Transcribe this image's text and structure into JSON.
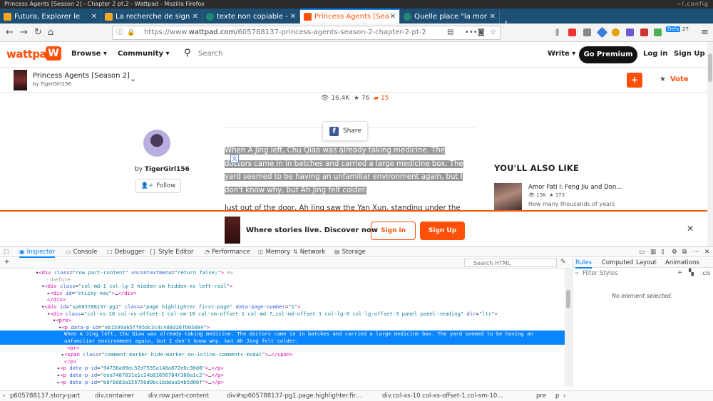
{
  "window": {
    "title": "Princess Agents [Season 2] - Chapter 2 pt.2 - Wattpad - Mozilla Firefox",
    "corner": "~/.config"
  },
  "tabs": [
    {
      "label": "Futura, Explorer le",
      "color": "#f5a623",
      "active": false
    },
    {
      "label": "La recherche de sign",
      "color": "#f5a623",
      "active": false
    },
    {
      "label": "texte non copiable -",
      "color": "#2b6",
      "active": false
    },
    {
      "label": "Princess Agents [Sea",
      "color": "#ff500a",
      "active": true
    },
    {
      "label": "Quelle place \"la mor",
      "color": "#2b6",
      "active": false
    }
  ],
  "nav": {
    "back": "←",
    "forward": "→",
    "reload": "↻",
    "home": "⌂",
    "url_prefix": "https://www.",
    "url_domain": "wattpad.com",
    "url_path": "/605788137-princess-agents-season-2-chapter-2-pt-2",
    "more": "•••",
    "menu": "≡",
    "profile_badge": "Defa",
    "counter": "27"
  },
  "site": {
    "brand": "wattpad",
    "browse": "Browse ▾",
    "community": "Community ▾",
    "search_placeholder": "Search",
    "write": "Write ▾",
    "premium": "Go Premium",
    "login": "Log in",
    "signup": "Sign Up"
  },
  "story": {
    "title": "Princess Agents [Season 2]",
    "by": "by TigerGirl156",
    "plus": "+",
    "vote": "Vote"
  },
  "stats": {
    "views": "16.4K",
    "votes": "76",
    "comments": "15"
  },
  "share": "Share",
  "author": {
    "by": "by ",
    "name": "TigerGirl156",
    "follow": "Follow"
  },
  "paragraph_selected": "When A Jing left, Chu Qiao was already taking medicine. The doctors came in in batches and carried a large medicine box. The yard seemed to be having an unfamiliar environment again, but I don't know why, but Ah Jing felt colder.",
  "paragraph_next": "Just out of the door, Ah Jing saw the Yan Xun, standing under the",
  "sidebar": {
    "heading": "YOU'LL ALSO LIKE",
    "rec_title": "Amor Fati I: Feng Jiu and Don...",
    "rec_reads": "13K",
    "rec_votes": "373",
    "rec_desc": "How many thousands of years"
  },
  "banner": {
    "message": "Where stories live. Discover now",
    "signin": "Sign in",
    "signup": "Sign Up",
    "close": "✕"
  },
  "devtools": {
    "tabs": [
      "Inspector",
      "Console",
      "Debugger",
      "Style Editor",
      "Performance",
      "Memory",
      "Network",
      "Storage"
    ],
    "search_placeholder": "Search HTML",
    "right_tabs": [
      "Rules",
      "Computed",
      "Layout",
      "Animations"
    ],
    "filter_placeholder": "Filter Styles",
    "cls": ".cls",
    "no_element": "No element selected.",
    "breadcrumbs": [
      "p605788137.story-part",
      "div.container",
      "div.row.part-content",
      "div#sp605788137-pg1.page.highlighter.fir…",
      "div.col-xs-10.col-xs-offset-1.col-sm-10…",
      "pre",
      "p"
    ]
  },
  "tree": [
    {
      "indent": 50,
      "html": "▾<span class=\"tg\">&lt;div</span> <span class=\"at\">class</span>=<span class=\"av\">\"row part-content\"</span> <span class=\"at\">oncontextmenu</span>=<span class=\"av\">\"return false;\"</span><span class=\"tg\">&gt;</span> <span class=\"tw\">ev</span>"
    },
    {
      "indent": 64,
      "html": "<span class=\"tw\">::before</span>"
    },
    {
      "indent": 58,
      "html": "▾<span class=\"tg\">&lt;div</span> <span class=\"at\">class</span>=<span class=\"av\">\"col-md-1 col-lg-3 hidden-sm hidden-xs left-rail\"</span><span class=\"tg\">&gt;</span>"
    },
    {
      "indent": 66,
      "html": "▸<span class=\"tg\">&lt;div</span> <span class=\"at\">id</span>=<span class=\"av\">\"sticky-nav\"</span><span class=\"tg\">&gt;</span>…<span class=\"tg\">&lt;/div&gt;</span>"
    },
    {
      "indent": 66,
      "html": "<span class=\"tg\">&lt;/div&gt;</span>"
    },
    {
      "indent": 58,
      "html": "▾<span class=\"tg\">&lt;div</span> <span class=\"at\">id</span>=<span class=\"av\">\"sp605788137-pg1\"</span> <span class=\"at\">class</span>=<span class=\"av\">\"page highlighter first-page\"</span> <span class=\"at\">data-page-number</span>=<span class=\"av\">\"1\"</span><span class=\"tg\">&gt;</span>"
    },
    {
      "indent": 66,
      "html": "▾<span class=\"tg\">&lt;div</span> <span class=\"at\">class</span>=<span class=\"av\">\"col-xs-10 col-xs-offset-1 col-sm-10 col-sm-offset-1 col-md-7…col-md-offset-1 col-lg-6 col-lg-offset-3 panel panel-reading\"</span> <span class=\"at\">dir</span>=<span class=\"av\">\"ltr\"</span><span class=\"tg\">&gt;</span>"
    },
    {
      "indent": 74,
      "html": "▾<span class=\"tg\">&lt;pre&gt;</span>"
    },
    {
      "indent": 82,
      "html": "▾<span class=\"tg\">&lt;p</span> <span class=\"at\">data-p-id</span>=<span class=\"av\">\"eb1599a65ff95dc3c4c488d26fb05084\"</span><span class=\"tg\">&gt;</span>"
    },
    {
      "indent": 90,
      "sel": true,
      "html": "When A Jing left, Chu Qiao was already taking medicine. The doctors came in in batches and carried a large medicine box. The yard seemed to be having an"
    },
    {
      "indent": 90,
      "sel": true,
      "html": "unfamiliar environment again, but I don't know why, but Ah Jing felt colder."
    },
    {
      "indent": 94,
      "html": "<span class=\"tg\">&lt;br&gt;</span>"
    },
    {
      "indent": 86,
      "html": "▸<span class=\"tg\">&lt;span</span> <span class=\"at\">class</span>=<span class=\"av\">\"comment-marker hide-marker on-inline-comments-modal\"</span><span class=\"tg\">&gt;</span>…<span class=\"tg\">&lt;/span&gt;</span>"
    },
    {
      "indent": 90,
      "html": "<span class=\"tg\">&lt;/p&gt;</span>"
    },
    {
      "indent": 80,
      "html": "▸<span class=\"tg\">&lt;p</span> <span class=\"at\">data-p-id</span>=<span class=\"av\">\"94738a09dc52d7535a148a872e0c30d8\"</span><span class=\"tg\">&gt;</span>…<span class=\"tg\">&lt;/p&gt;</span>"
    },
    {
      "indent": 80,
      "html": "▸<span class=\"tg\">&lt;p</span> <span class=\"at\">data-p-id</span>=<span class=\"av\">\"eea7487831e1c24b81056784f380a1c2\"</span><span class=\"tg\">&gt;</span>…<span class=\"tg\">&lt;/p&gt;</span>"
    },
    {
      "indent": 80,
      "html": "▸<span class=\"tg\">&lt;p</span> <span class=\"at\">data-p-id</span>=<span class=\"av\">\"b0f8dd3a155756d0bc1bddaa94b5d08f\"</span><span class=\"tg\">&gt;</span>…<span class=\"tg\">&lt;/p&gt;</span>"
    }
  ]
}
